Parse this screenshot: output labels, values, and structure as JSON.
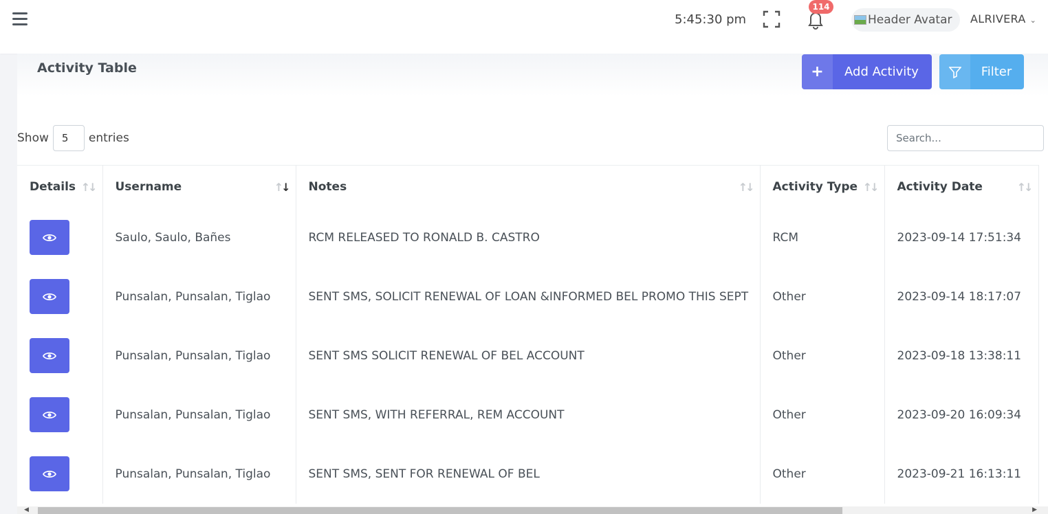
{
  "header": {
    "menu_icon": "hamburger-menu-icon",
    "time": "5:45:30 pm",
    "notification_count": "114",
    "avatar_alt": "Header Avatar",
    "user_name": "ALRIVERA"
  },
  "card": {
    "title": "Activity Table",
    "add_button": "Add Activity",
    "filter_button": "Filter"
  },
  "controls": {
    "show_label": "Show",
    "entries_value": "5",
    "entries_label": "entries",
    "search_placeholder": "Search..."
  },
  "table": {
    "columns": [
      "Details",
      "Username",
      "Notes",
      "Activity Type",
      "Activity Date"
    ],
    "rows": [
      {
        "username": "Saulo, Saulo, Bañes",
        "notes": "RCM RELEASED TO RONALD B. CASTRO",
        "type": "RCM",
        "date": "2023-09-14 17:51:34"
      },
      {
        "username": "Punsalan, Punsalan, Tiglao",
        "notes": "SENT SMS, SOLICIT RENEWAL OF LOAN &INFORMED BEL PROMO THIS SEPT",
        "type": "Other",
        "date": "2023-09-14 18:17:07"
      },
      {
        "username": "Punsalan, Punsalan, Tiglao",
        "notes": "SENT SMS SOLICIT RENEWAL OF BEL ACCOUNT",
        "type": "Other",
        "date": "2023-09-18 13:38:11"
      },
      {
        "username": "Punsalan, Punsalan, Tiglao",
        "notes": "SENT SMS, WITH REFERRAL, REM ACCOUNT",
        "type": "Other",
        "date": "2023-09-20 16:09:34"
      },
      {
        "username": "Punsalan, Punsalan, Tiglao",
        "notes": "SENT SMS, SENT FOR RENEWAL OF BEL",
        "type": "Other",
        "date": "2023-09-21 16:13:11"
      }
    ]
  },
  "colors": {
    "primary": "#5a66e6",
    "info": "#55aeee",
    "badge": "#f06a6a"
  }
}
